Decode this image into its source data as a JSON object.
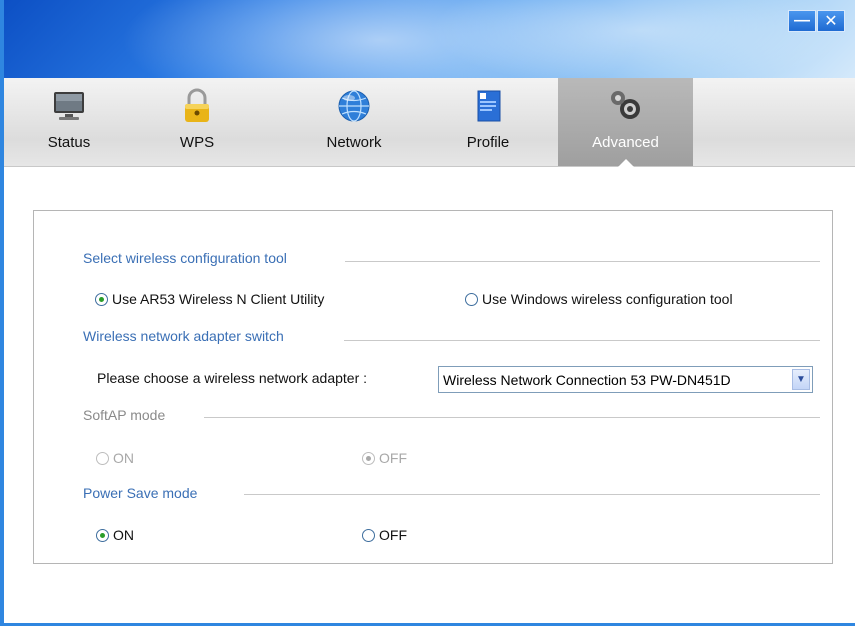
{
  "window": {
    "minimize_glyph": "—",
    "close_glyph": "✕"
  },
  "tabs": [
    {
      "label": "Status",
      "icon": "monitor-icon",
      "active": false
    },
    {
      "label": "WPS",
      "icon": "padlock-icon",
      "active": false
    },
    {
      "label": "Network",
      "icon": "globe-icon",
      "active": false
    },
    {
      "label": "Profile",
      "icon": "document-icon",
      "active": false
    },
    {
      "label": "Advanced",
      "icon": "gears-icon",
      "active": true
    }
  ],
  "sections": {
    "config_tool": {
      "title": "Select wireless configuration tool",
      "options": [
        {
          "label": "Use AR53 Wireless N Client Utility",
          "checked": true
        },
        {
          "label": "Use Windows wireless configuration tool",
          "checked": false
        }
      ]
    },
    "adapter_switch": {
      "title": "Wireless network adapter switch",
      "prompt": "Please choose a wireless network adapter :",
      "selected": "Wireless Network Connection 53  PW-DN451D"
    },
    "softap": {
      "title": "SoftAP mode",
      "disabled": true,
      "options": [
        {
          "label": "ON",
          "checked": false
        },
        {
          "label": "OFF",
          "checked": true
        }
      ]
    },
    "power_save": {
      "title": "Power Save mode",
      "options": [
        {
          "label": "ON",
          "checked": true
        },
        {
          "label": "OFF",
          "checked": false
        }
      ]
    }
  },
  "colors": {
    "title_bar": "#2d7ee6",
    "section_title": "#3a6fb5",
    "active_tab": "#a8a8a8",
    "radio_checked": "#2a9d2a"
  }
}
